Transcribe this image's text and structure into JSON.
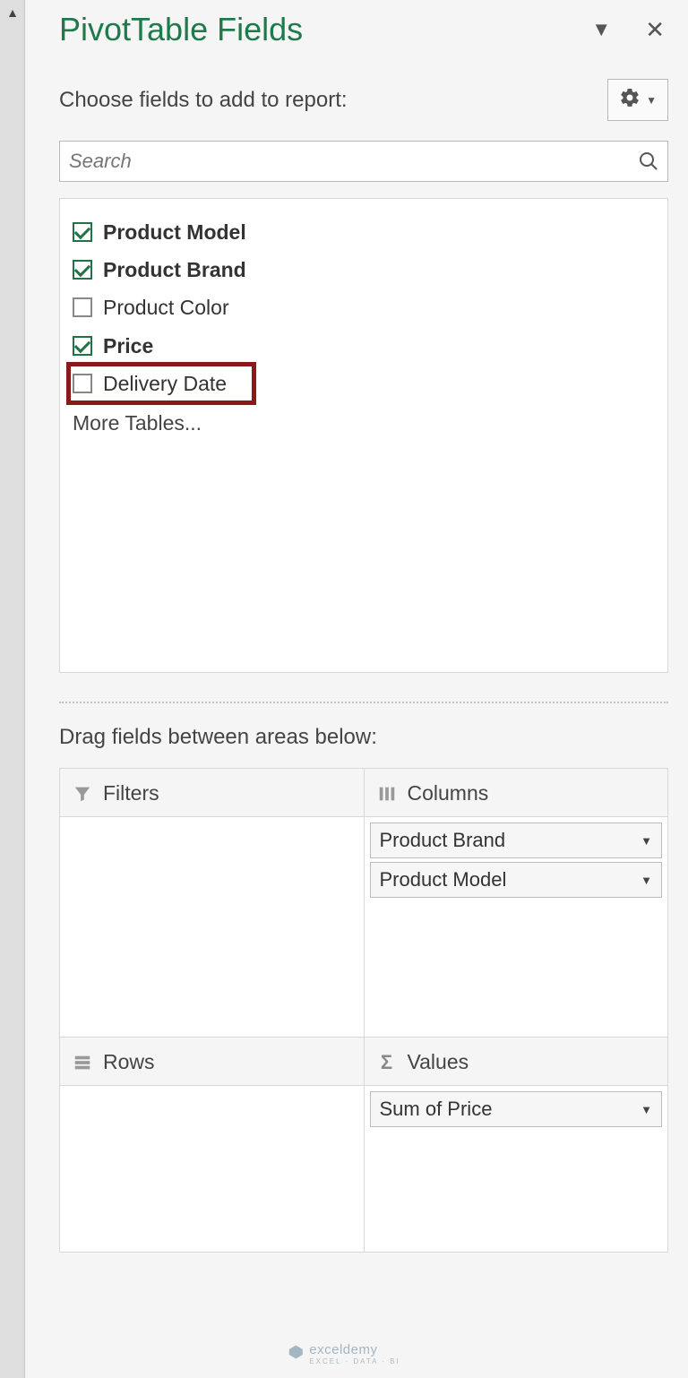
{
  "panel": {
    "title": "PivotTable Fields",
    "instruction": "Choose fields to add to report:",
    "search_placeholder": "Search",
    "fields": [
      {
        "label": "Product Model",
        "checked": true,
        "bold": true,
        "highlight": false
      },
      {
        "label": "Product Brand",
        "checked": true,
        "bold": true,
        "highlight": false
      },
      {
        "label": "Product Color",
        "checked": false,
        "bold": false,
        "highlight": false
      },
      {
        "label": "Price",
        "checked": true,
        "bold": true,
        "highlight": false
      },
      {
        "label": "Delivery Date",
        "checked": false,
        "bold": false,
        "highlight": true
      }
    ],
    "more_tables": "More Tables...",
    "drag_instruction": "Drag fields between areas below:",
    "areas": {
      "filters": {
        "label": "Filters",
        "items": []
      },
      "columns": {
        "label": "Columns",
        "items": [
          "Product Brand",
          "Product Model"
        ]
      },
      "rows": {
        "label": "Rows",
        "items": []
      },
      "values": {
        "label": "Values",
        "items": [
          "Sum of Price"
        ]
      }
    }
  },
  "watermark": {
    "brand": "exceldemy",
    "sub": "EXCEL · DATA · BI"
  }
}
